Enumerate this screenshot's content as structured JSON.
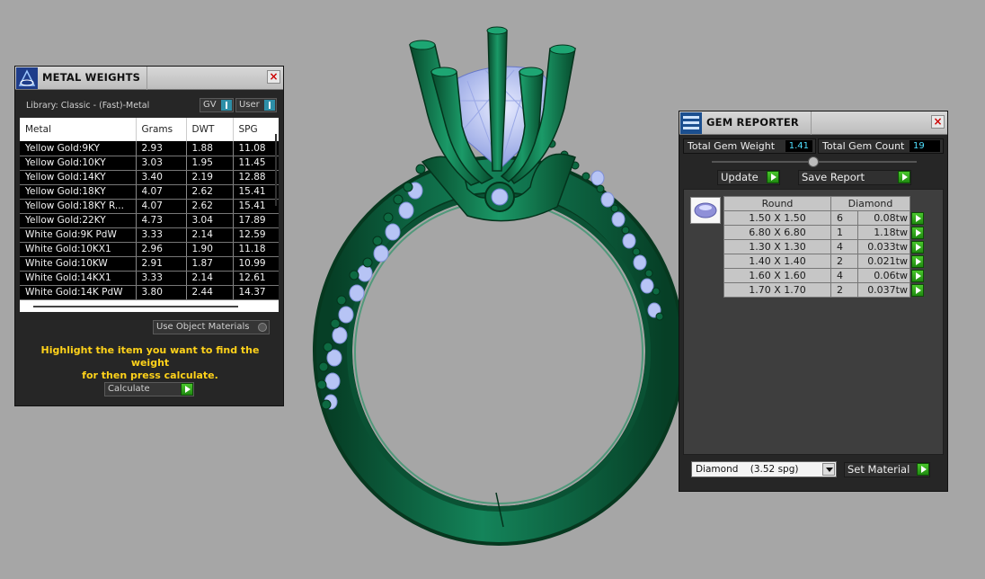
{
  "metal_weights": {
    "title": "METAL WEIGHTS",
    "library": "Library: Classic - (Fast)-Metal",
    "gv_label": "GV",
    "user_label": "User",
    "columns": [
      "Metal",
      "Grams",
      "DWT",
      "SPG"
    ],
    "rows": [
      [
        "Yellow Gold:9KY",
        "2.93",
        "1.88",
        "11.08"
      ],
      [
        "Yellow Gold:10KY",
        "3.03",
        "1.95",
        "11.45"
      ],
      [
        "Yellow Gold:14KY",
        "3.40",
        "2.19",
        "12.88"
      ],
      [
        "Yellow Gold:18KY",
        "4.07",
        "2.62",
        "15.41"
      ],
      [
        "Yellow Gold:18KY R...",
        "4.07",
        "2.62",
        "15.41"
      ],
      [
        "Yellow Gold:22KY",
        "4.73",
        "3.04",
        "17.89"
      ],
      [
        "White Gold:9K PdW",
        "3.33",
        "2.14",
        "12.59"
      ],
      [
        "White Gold:10KX1",
        "2.96",
        "1.90",
        "11.18"
      ],
      [
        "White Gold:10KW",
        "2.91",
        "1.87",
        "10.99"
      ],
      [
        "White Gold:14KX1",
        "3.33",
        "2.14",
        "12.61"
      ],
      [
        "White Gold:14K PdW",
        "3.80",
        "2.44",
        "14.37"
      ]
    ],
    "use_object_materials": "Use Object Materials",
    "instruction_line1": "Highlight the item you want to find the weight",
    "instruction_line2": "for then press calculate.",
    "calculate_label": "Calculate"
  },
  "gem_reporter": {
    "title": "GEM REPORTER",
    "total_weight_label": "Total Gem Weight",
    "total_weight_value": "1.41",
    "total_count_label": "Total Gem Count",
    "total_count_value": "19",
    "update_label": "Update",
    "save_report_label": "Save Report",
    "table_headers": [
      "Round",
      "Diamond"
    ],
    "rows": [
      [
        "1.50 X 1.50",
        "6",
        "0.08tw"
      ],
      [
        "6.80 X 6.80",
        "1",
        "1.18tw"
      ],
      [
        "1.30 X 1.30",
        "4",
        "0.033tw"
      ],
      [
        "1.40 X 1.40",
        "2",
        "0.021tw"
      ],
      [
        "1.60 X 1.60",
        "4",
        "0.06tw"
      ],
      [
        "1.70 X 1.70",
        "2",
        "0.037tw"
      ]
    ],
    "material_select": "Diamond    (3.52 spg)",
    "set_material_label": "Set Material"
  },
  "colors": {
    "background": "#a6a6a6",
    "panel": "#262626",
    "ring_green": "#0f6e47",
    "gem_blue": "#a9b8f2",
    "instruction_yellow": "#ffd21a",
    "value_cyan": "#4fe0ff"
  }
}
